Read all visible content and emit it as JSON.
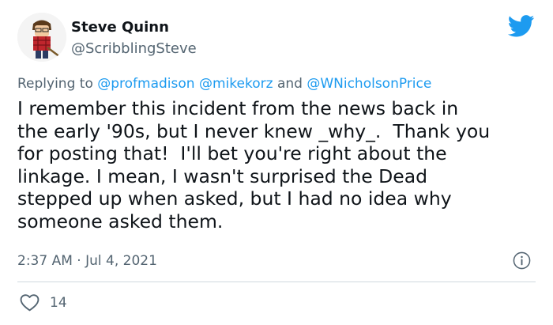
{
  "author": {
    "name": "Steve Quinn",
    "handle": "@ScribblingSteve",
    "avatar_icon": "cartoon-avatar-icon"
  },
  "brand": {
    "logo_icon": "twitter-bird-icon",
    "accent_color": "#1d9bf0"
  },
  "reply": {
    "prefix": "Replying to",
    "mention_1": "@profmadison",
    "mention_2": "@mikekorz",
    "conjunction": "and",
    "mention_3": "@WNicholsonPrice"
  },
  "tweet": {
    "text": "I remember this incident from the news back in\nthe early '90s, but I never knew _why_.  Thank you\nfor posting that!  I'll bet you're right about the\nlinkage. I mean, I wasn't surprised the Dead\nstepped up when asked, but I had no idea why\nsomeone asked them.",
    "timestamp": "2:37 AM · Jul 4, 2021"
  },
  "actions": {
    "like_icon": "heart-icon",
    "like_count": "14",
    "info_icon": "info-icon"
  }
}
